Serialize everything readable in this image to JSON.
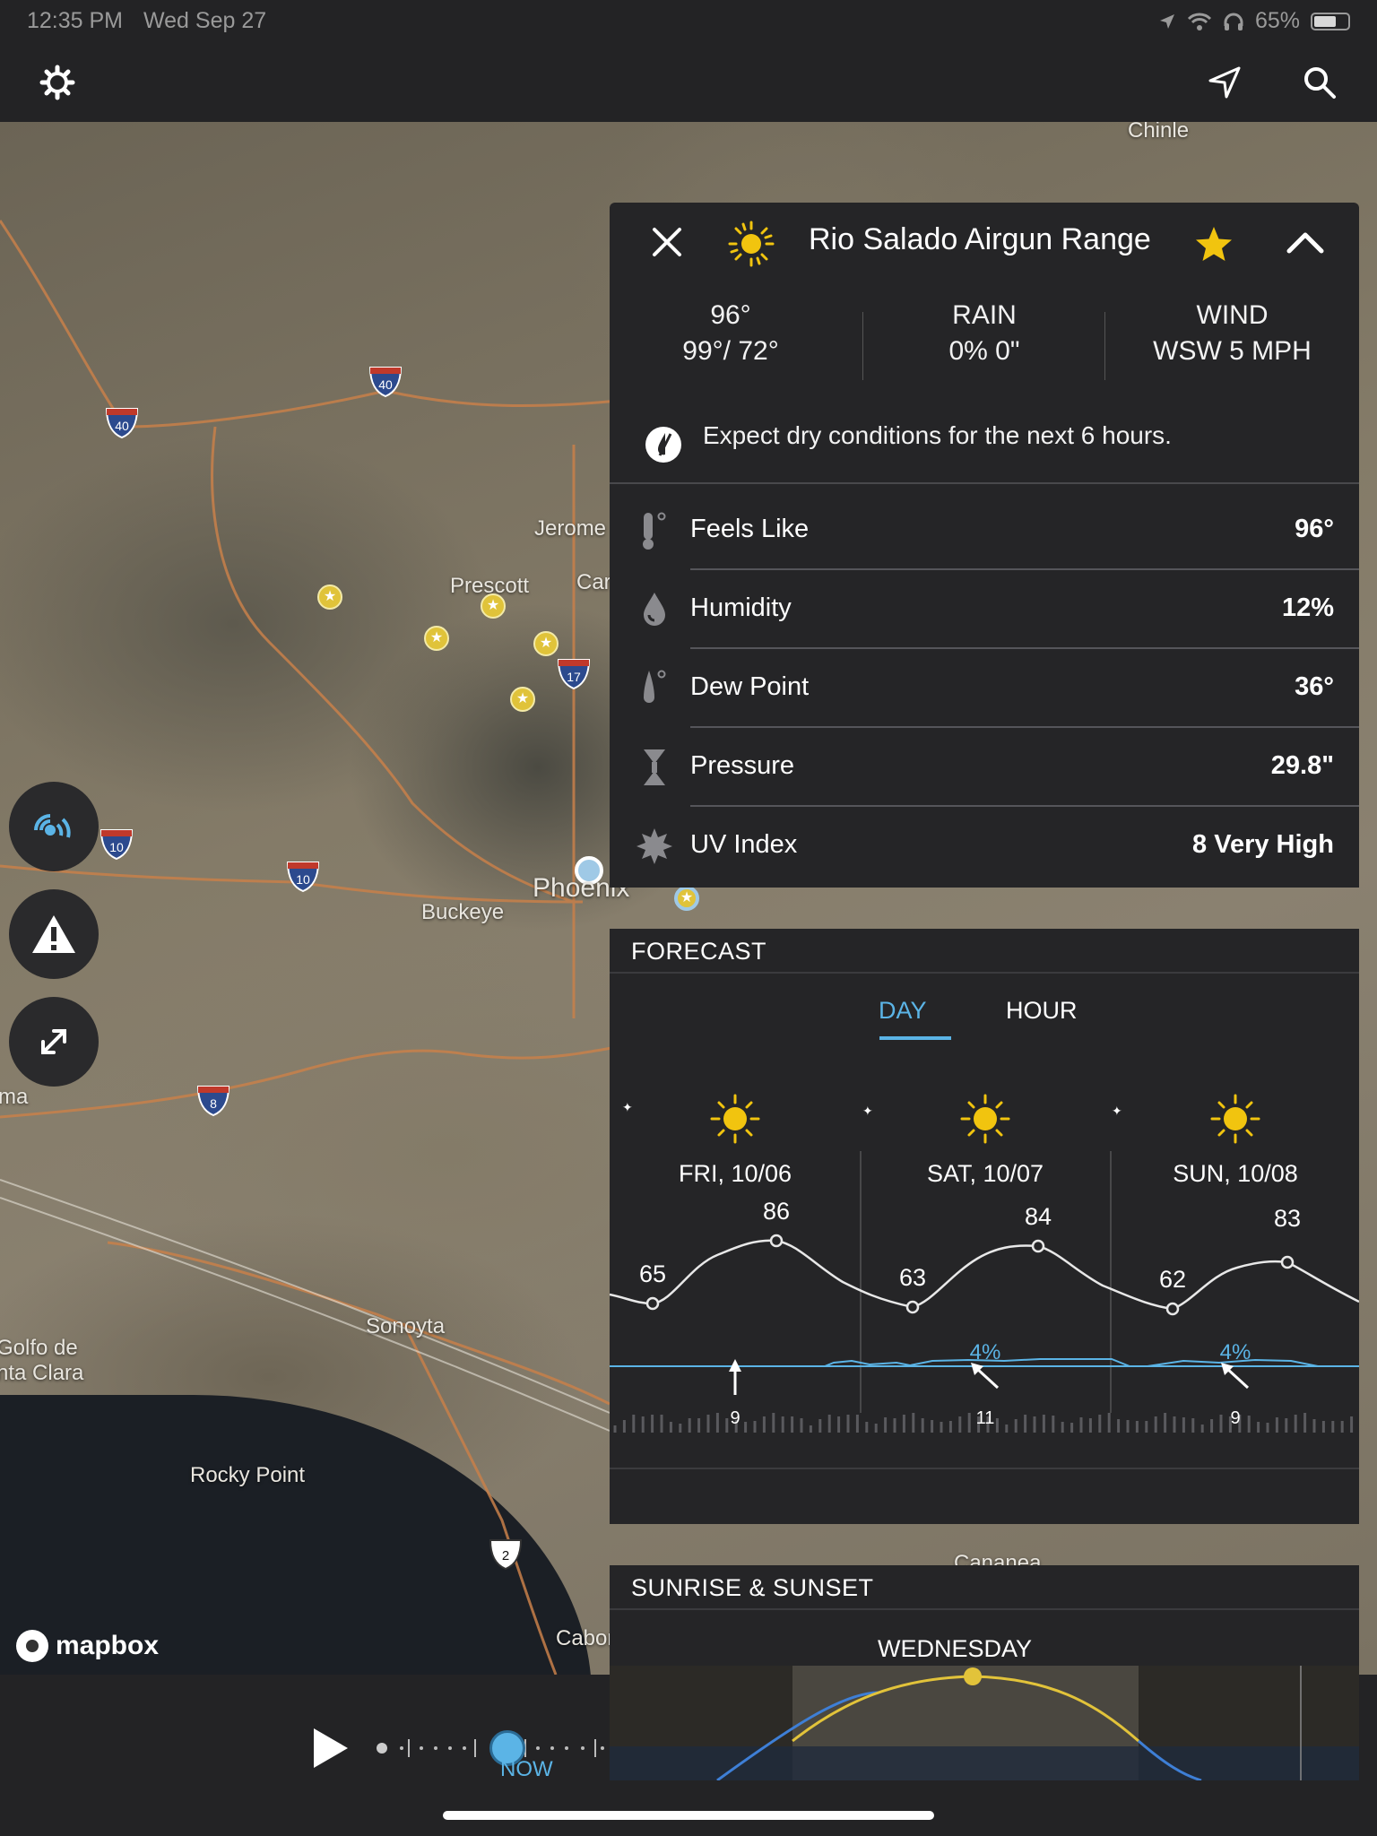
{
  "status_bar": {
    "time": "12:35 PM",
    "date": "Wed Sep 27",
    "battery": "65%"
  },
  "map": {
    "labels": [
      "Chinle",
      "Jerome",
      "Prescott",
      "Car",
      "Phoenix",
      "Buckeye",
      "Sonoyta",
      "Rocky Point",
      "Caborca",
      "Golfo de",
      "nta Clara",
      "ma",
      "Cananea"
    ],
    "shields": [
      "40",
      "40",
      "17",
      "10",
      "10",
      "8",
      "2"
    ],
    "attribution": "mapbox"
  },
  "card": {
    "location": "Rio Salado Airgun Range",
    "temp": "96°",
    "hi_lo": "99°/ 72°",
    "rain_label": "RAIN",
    "rain_value": "0% 0\"",
    "wind_label": "WIND",
    "wind_value": "WSW 5 MPH",
    "notice": "Expect dry conditions for the next 6 hours.",
    "details": [
      {
        "label": "Feels Like",
        "value": "96°",
        "icon": "thermometer-icon"
      },
      {
        "label": "Humidity",
        "value": "12%",
        "icon": "water-drop-icon"
      },
      {
        "label": "Dew Point",
        "value": "36°",
        "icon": "dew-point-icon"
      },
      {
        "label": "Pressure",
        "value": "29.8\"",
        "icon": "pressure-icon"
      },
      {
        "label": "UV Index",
        "value": "8 Very High",
        "icon": "uv-sun-icon"
      }
    ]
  },
  "forecast": {
    "title": "FORECAST",
    "tabs": {
      "day": "DAY",
      "hour": "HOUR",
      "active": "DAY"
    },
    "days": [
      "FRI, 10/06",
      "SAT, 10/07",
      "SUN, 10/08"
    ],
    "lows": [
      "65",
      "63",
      "62"
    ],
    "highs": [
      "86",
      "84",
      "83"
    ],
    "precip": [
      "4%",
      "4%"
    ],
    "wind_speeds": [
      "9",
      "11",
      "9"
    ],
    "accent_color": "#5bb4e6"
  },
  "sunrise": {
    "title": "SUNRISE & SUNSET",
    "day": "WEDNESDAY"
  },
  "timeline": {
    "now_label": "NOW"
  }
}
